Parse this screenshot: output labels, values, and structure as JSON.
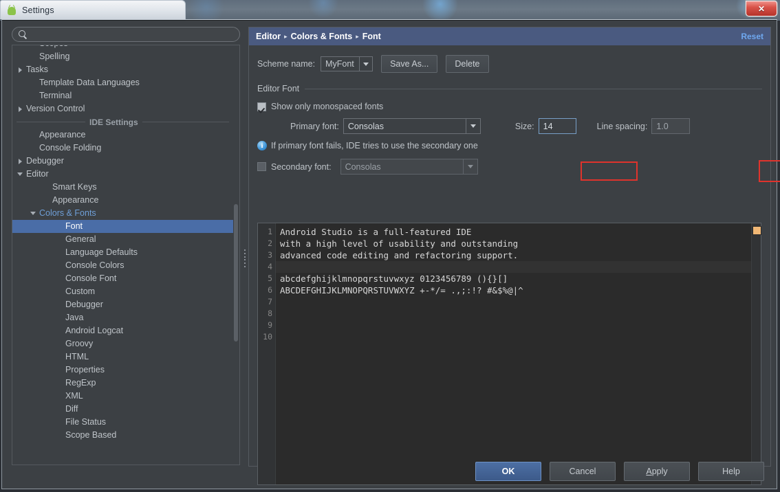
{
  "window": {
    "title": "Settings",
    "app_icon": "android-icon",
    "close_label": "✕"
  },
  "search": {
    "value": "",
    "placeholder": "",
    "icon": "search-icon"
  },
  "tree": {
    "items": [
      {
        "label": "Scopes",
        "indent": 1,
        "arrow": "none",
        "state": "normal"
      },
      {
        "label": "Spelling",
        "indent": 1,
        "arrow": "none",
        "state": "normal"
      },
      {
        "label": "Tasks",
        "indent": 0,
        "arrow": "collapsed",
        "state": "normal"
      },
      {
        "label": "Template Data Languages",
        "indent": 1,
        "arrow": "none",
        "state": "normal"
      },
      {
        "label": "Terminal",
        "indent": 1,
        "arrow": "none",
        "state": "normal"
      },
      {
        "label": "Version Control",
        "indent": 0,
        "arrow": "collapsed",
        "state": "normal"
      },
      {
        "label": "IDE Settings",
        "indent": 0,
        "arrow": "none",
        "state": "separator"
      },
      {
        "label": "Appearance",
        "indent": 1,
        "arrow": "none",
        "state": "normal"
      },
      {
        "label": "Console Folding",
        "indent": 1,
        "arrow": "none",
        "state": "normal"
      },
      {
        "label": "Debugger",
        "indent": 0,
        "arrow": "collapsed",
        "state": "normal"
      },
      {
        "label": "Editor",
        "indent": 0,
        "arrow": "expanded",
        "state": "normal"
      },
      {
        "label": "Smart Keys",
        "indent": 2,
        "arrow": "none",
        "state": "normal"
      },
      {
        "label": "Appearance",
        "indent": 2,
        "arrow": "none",
        "state": "normal"
      },
      {
        "label": "Colors & Fonts",
        "indent": 1,
        "arrow": "expanded",
        "state": "expanded-blue"
      },
      {
        "label": "Font",
        "indent": 3,
        "arrow": "none",
        "state": "selected"
      },
      {
        "label": "General",
        "indent": 3,
        "arrow": "none",
        "state": "normal"
      },
      {
        "label": "Language Defaults",
        "indent": 3,
        "arrow": "none",
        "state": "normal"
      },
      {
        "label": "Console Colors",
        "indent": 3,
        "arrow": "none",
        "state": "normal"
      },
      {
        "label": "Console Font",
        "indent": 3,
        "arrow": "none",
        "state": "normal"
      },
      {
        "label": "Custom",
        "indent": 3,
        "arrow": "none",
        "state": "normal"
      },
      {
        "label": "Debugger",
        "indent": 3,
        "arrow": "none",
        "state": "normal"
      },
      {
        "label": "Java",
        "indent": 3,
        "arrow": "none",
        "state": "normal"
      },
      {
        "label": "Android Logcat",
        "indent": 3,
        "arrow": "none",
        "state": "normal"
      },
      {
        "label": "Groovy",
        "indent": 3,
        "arrow": "none",
        "state": "normal"
      },
      {
        "label": "HTML",
        "indent": 3,
        "arrow": "none",
        "state": "normal"
      },
      {
        "label": "Properties",
        "indent": 3,
        "arrow": "none",
        "state": "normal"
      },
      {
        "label": "RegExp",
        "indent": 3,
        "arrow": "none",
        "state": "normal"
      },
      {
        "label": "XML",
        "indent": 3,
        "arrow": "none",
        "state": "normal"
      },
      {
        "label": "Diff",
        "indent": 3,
        "arrow": "none",
        "state": "normal"
      },
      {
        "label": "File Status",
        "indent": 3,
        "arrow": "none",
        "state": "normal"
      },
      {
        "label": "Scope Based",
        "indent": 3,
        "arrow": "none",
        "state": "normal"
      }
    ]
  },
  "breadcrumb": {
    "parts": [
      "Editor",
      "Colors & Fonts",
      "Font"
    ],
    "separator": "▸",
    "reset_label": "Reset"
  },
  "scheme": {
    "label": "Scheme name:",
    "value": "MyFont",
    "save_as_label": "Save As...",
    "delete_label": "Delete"
  },
  "editor_font": {
    "group_title": "Editor Font",
    "monospaced_label": "Show only monospaced fonts",
    "monospaced_checked": true,
    "primary_label": "Primary font:",
    "primary_value": "Consolas",
    "size_label": "Size:",
    "size_value": "14",
    "line_spacing_label": "Line spacing:",
    "line_spacing_value": "1.0",
    "info_text": "If primary font fails, IDE tries to use the secondary one",
    "info_icon": "info-icon",
    "secondary_label": "Secondary font:",
    "secondary_value": "Consolas",
    "secondary_checked": false
  },
  "preview": {
    "line_numbers": [
      "1",
      "2",
      "3",
      "4",
      "5",
      "6",
      "7",
      "8",
      "9",
      "10"
    ],
    "lines": [
      "Android Studio is a full-featured IDE",
      "with a high level of usability and outstanding",
      "advanced code editing and refactoring support.",
      "",
      "abcdefghijklmnopqrstuvwxyz 0123456789 (){}[]",
      "ABCDEFGHIJKLMNOPQRSTUVWXYZ +-*/= .,;:!? #&$%@|^",
      "",
      "",
      "",
      ""
    ],
    "caret_line_index": 3,
    "marker_color": "#f0b775"
  },
  "buttons": {
    "ok": "OK",
    "cancel": "Cancel",
    "apply_prefix": "A",
    "apply_rest": "pply",
    "help": "Help"
  },
  "colors": {
    "accent_selection": "#4a6da7",
    "breadcrumb_bg": "#4a5a80",
    "link": "#6fa8ef",
    "annotation": "#e0332c",
    "dialog_bg": "#3c4044",
    "editor_bg": "#2b2b2b"
  }
}
